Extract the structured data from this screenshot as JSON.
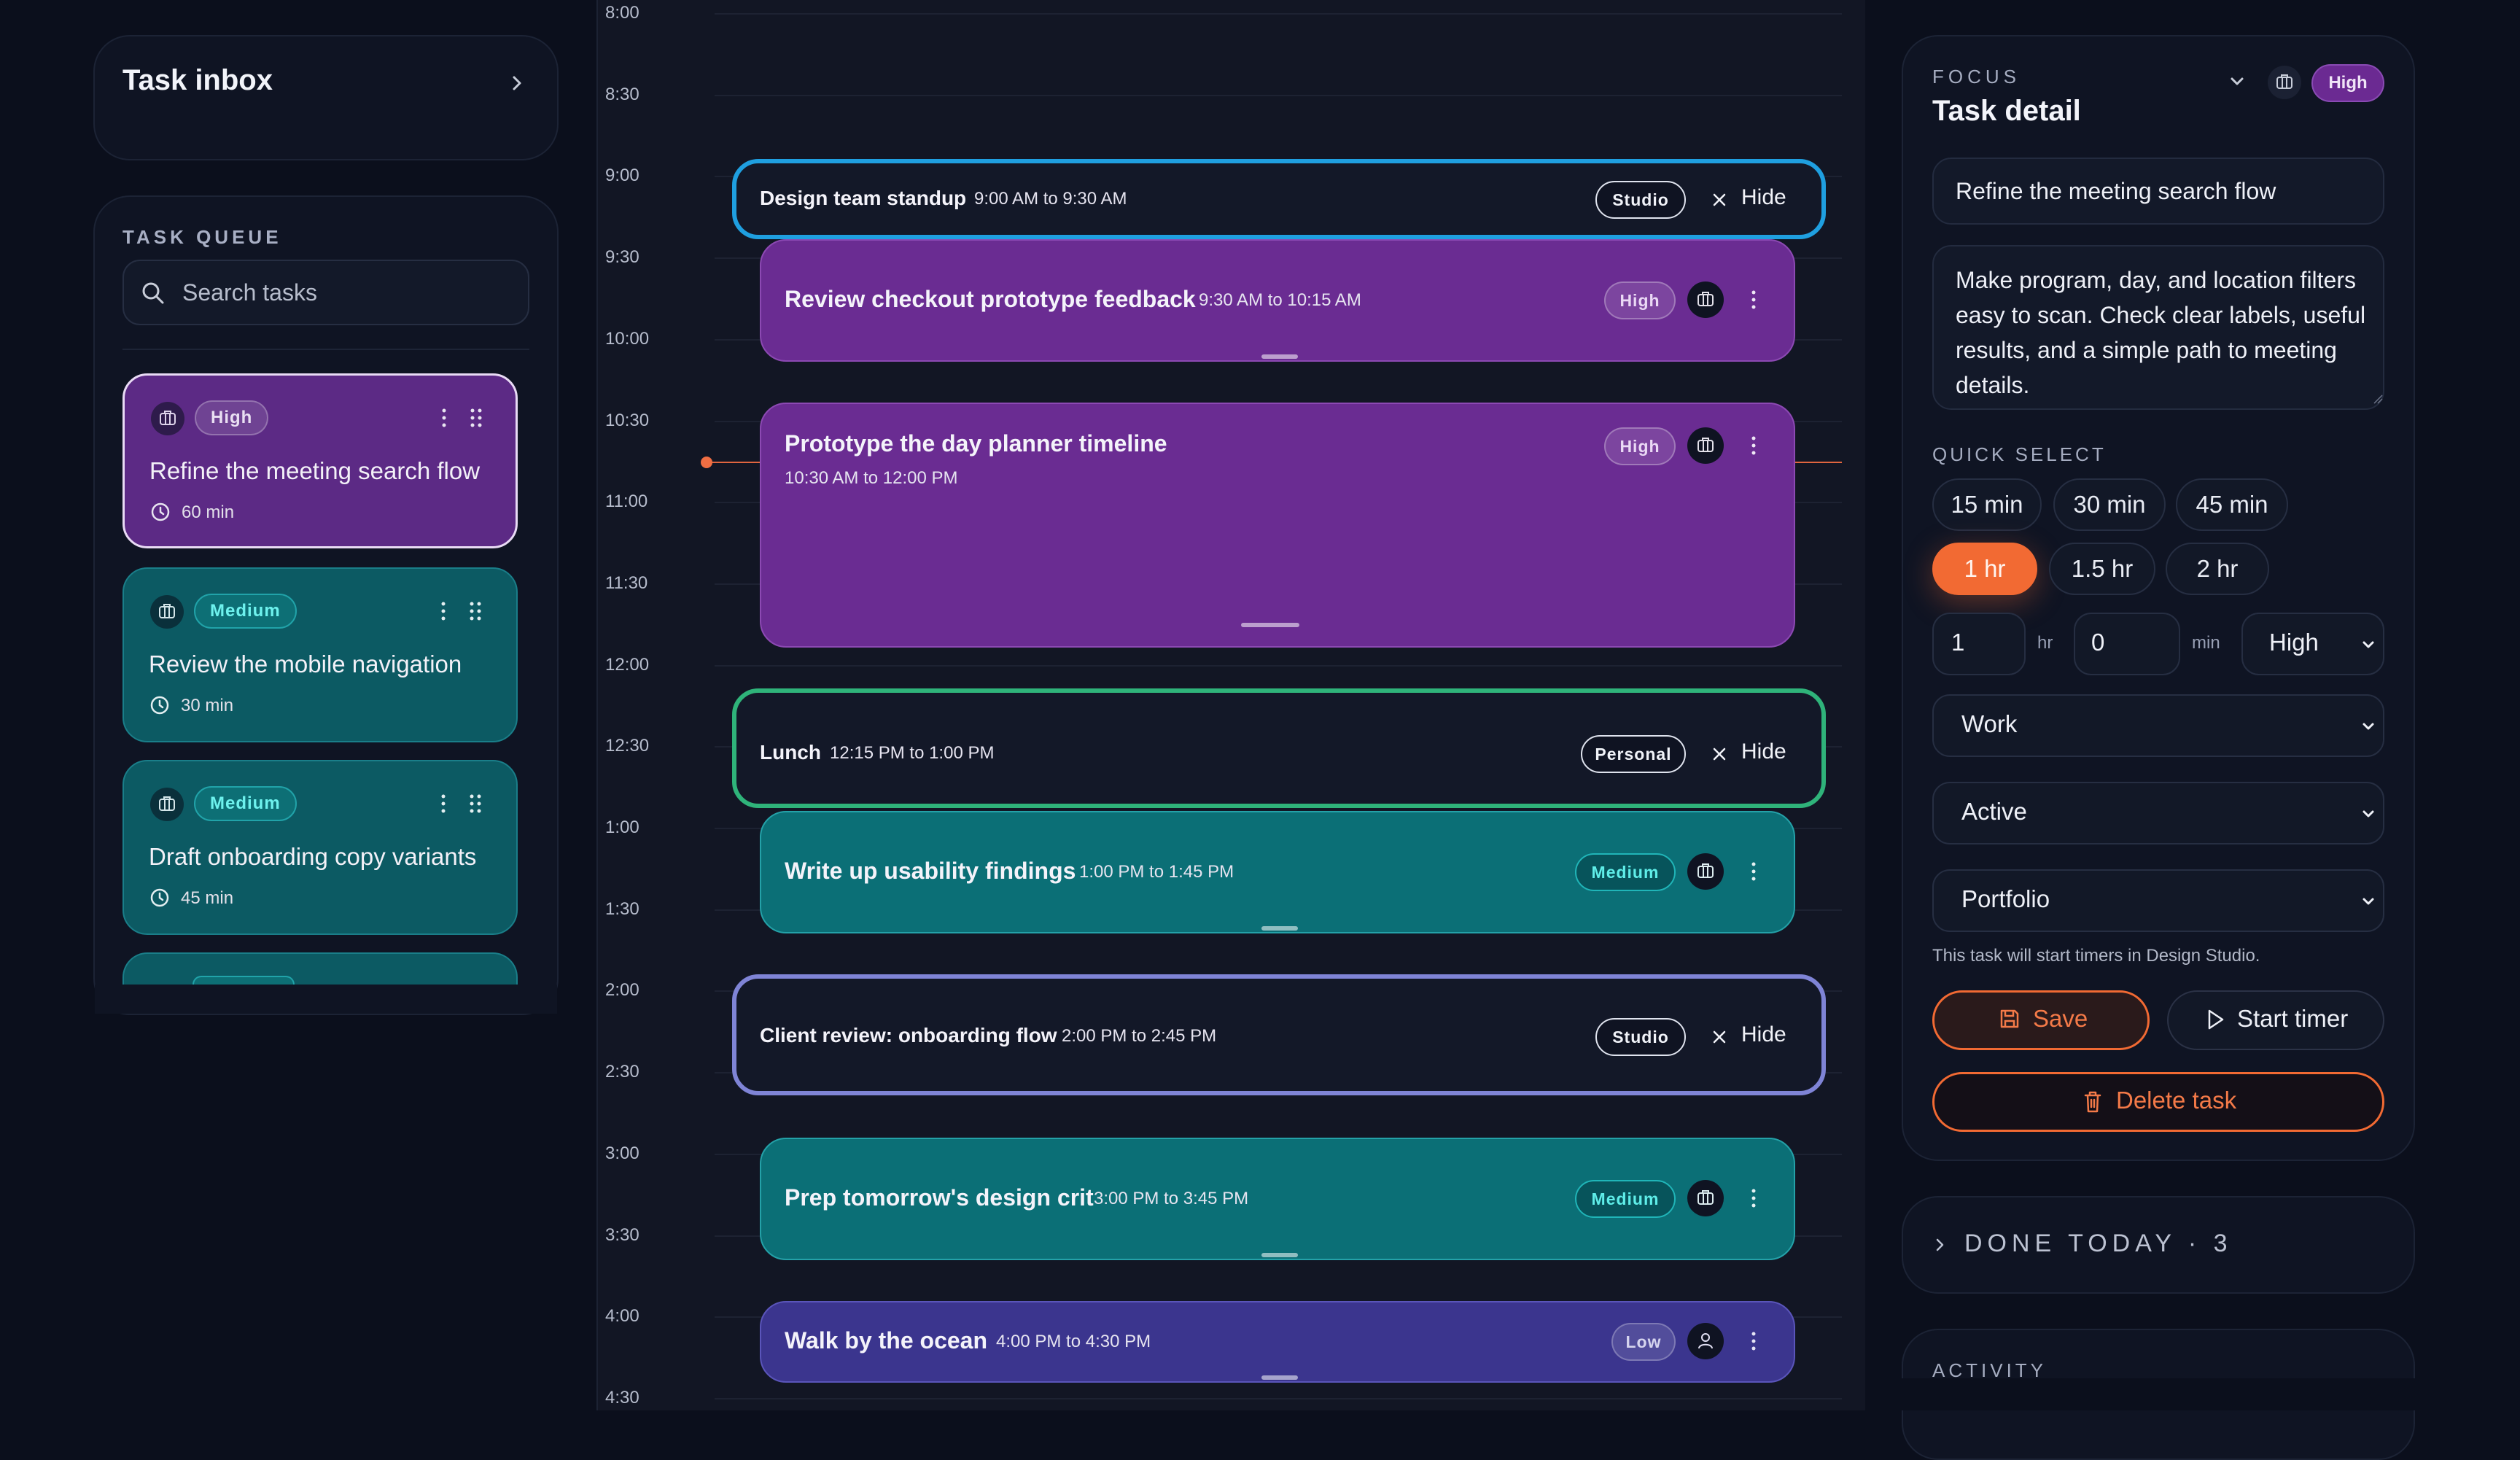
{
  "inbox": {
    "title": "Task inbox"
  },
  "queue": {
    "label": "TASK QUEUE",
    "search_placeholder": "Search tasks",
    "cards": [
      {
        "priority": "High",
        "title": "Refine the meeting search flow",
        "duration": "60 min"
      },
      {
        "priority": "Medium",
        "title": "Review the mobile navigation",
        "duration": "30 min"
      },
      {
        "priority": "Medium",
        "title": "Draft onboarding copy variants",
        "duration": "45 min"
      }
    ]
  },
  "calendar": {
    "times": [
      "8:00",
      "8:30",
      "9:00",
      "9:30",
      "10:00",
      "10:30",
      "11:00",
      "11:30",
      "12:00",
      "12:30",
      "1:00",
      "1:30",
      "2:00",
      "2:30",
      "3:00",
      "3:30",
      "4:00",
      "4:30"
    ],
    "events": {
      "standup": {
        "title": "Design team standup",
        "time": "9:00 AM to 9:30 AM",
        "tag": "Studio",
        "hide": "Hide"
      },
      "checkout": {
        "title": "Review checkout prototype feedback",
        "time": "9:30 AM to 10:15 AM",
        "tag": "High"
      },
      "timeline": {
        "title": "Prototype the day planner timeline",
        "time": "10:30 AM to 12:00 PM",
        "tag": "High"
      },
      "lunch": {
        "title": "Lunch",
        "time": "12:15 PM to 1:00 PM",
        "tag": "Personal",
        "hide": "Hide"
      },
      "usability": {
        "title": "Write up usability findings",
        "time": "1:00 PM to 1:45 PM",
        "tag": "Medium"
      },
      "client": {
        "title": "Client review: onboarding flow",
        "time": "2:00 PM to 2:45 PM",
        "tag": "Studio",
        "hide": "Hide"
      },
      "crit": {
        "title": "Prep tomorrow's design crit",
        "time": "3:00 PM to 3:45 PM",
        "tag": "Medium"
      },
      "walk": {
        "title": "Walk by the ocean",
        "time": "4:00 PM to 4:30 PM",
        "tag": "Low"
      }
    }
  },
  "detail": {
    "focus_label": "FOCUS",
    "title": "Task detail",
    "priority_badge": "High",
    "task_title": "Refine the meeting search flow",
    "description": "Make program, day, and location filters easy to scan. Check clear labels, useful results, and a simple path to meeting details.",
    "quick_select_label": "QUICK SELECT",
    "chips": [
      "15 min",
      "30 min",
      "45 min",
      "1 hr",
      "1.5 hr",
      "2 hr"
    ],
    "active_chip": "1 hr",
    "hours": "1",
    "hours_unit": "hr",
    "minutes": "0",
    "minutes_unit": "min",
    "priority": "High",
    "category": "Work",
    "status": "Active",
    "project": "Portfolio",
    "hint": "This task will start timers in Design Studio.",
    "save": "Save",
    "start_timer": "Start timer",
    "delete": "Delete task"
  },
  "done_today": {
    "label": "DONE TODAY · 3"
  },
  "activity": {
    "label": "ACTIVITY"
  },
  "colors": {
    "accent": "#f26a33",
    "high": "#6a2c92",
    "medium": "#0b6f76",
    "low": "#3b358e",
    "standup_outline": "#1f9fe0",
    "lunch_outline": "#2fb37a",
    "client_outline": "#7f84d6"
  }
}
